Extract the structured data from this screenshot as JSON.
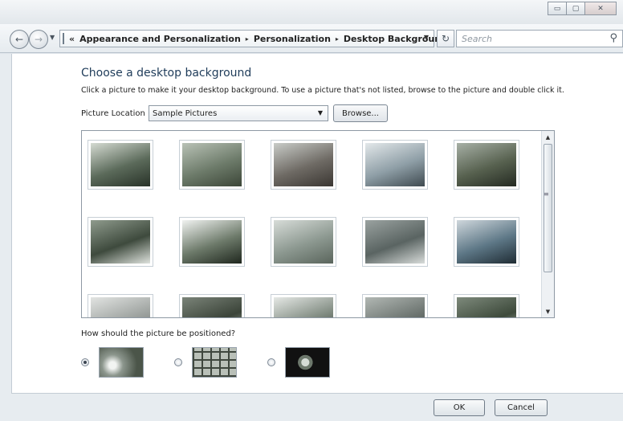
{
  "window": {
    "controls": {
      "minimize": "▭",
      "maximize": "▢",
      "close": "✕"
    }
  },
  "navbar": {
    "back_icon": "back-arrow-icon",
    "forward_icon": "forward-arrow-icon",
    "overflow": "«",
    "breadcrumbs": [
      "Appearance and Personalization",
      "Personalization",
      "Desktop Background"
    ],
    "crumb_separator": "▸",
    "search_placeholder": "Search"
  },
  "content": {
    "heading": "Choose a desktop background",
    "instructions": "Click a picture to make it your desktop background. To use a picture that's not listed, browse to the picture and double click it.",
    "location_label": "Picture Location",
    "location_value": "Sample Pictures",
    "browse_label": "Browse...",
    "thumbnails": [
      {
        "name": "tree-landscape",
        "palette": [
          "#d5dbd2",
          "#5b6a5a",
          "#283228"
        ]
      },
      {
        "name": "stream-field",
        "palette": [
          "#b9c2b6",
          "#6d7b6a",
          "#3c4638"
        ]
      },
      {
        "name": "desert-buttes",
        "palette": [
          "#c9ccc8",
          "#6e6a64",
          "#3a3632"
        ]
      },
      {
        "name": "lake-dock",
        "palette": [
          "#e3e8ea",
          "#8e9ea6",
          "#3f4a50"
        ]
      },
      {
        "name": "forest-path",
        "palette": [
          "#a7b0a6",
          "#57614f",
          "#242a22"
        ]
      },
      {
        "name": "flowers-grass",
        "palette": [
          "#8f9b8d",
          "#3e4a3d",
          "#dfe3de"
        ]
      },
      {
        "name": "white-flowers",
        "palette": [
          "#f1f3f1",
          "#6d7a6a",
          "#1f271e"
        ]
      },
      {
        "name": "daisy-field",
        "palette": [
          "#d7dcd8",
          "#8c9890",
          "#5a655c"
        ]
      },
      {
        "name": "sea-turtle",
        "palette": [
          "#9aa2a0",
          "#5a6462",
          "#d8dcda"
        ]
      },
      {
        "name": "whale-tail",
        "palette": [
          "#cfd7dc",
          "#5d7786",
          "#1f2c34"
        ]
      },
      {
        "name": "sand-dunes",
        "palette": [
          "#e2e4e2",
          "#9da29f",
          "#6a6e6b"
        ]
      },
      {
        "name": "toucan",
        "palette": [
          "#7b8479",
          "#3b4439",
          "#c2c8c0"
        ]
      },
      {
        "name": "bare-tree",
        "palette": [
          "#e6e9e6",
          "#7f8a80",
          "#2f362f"
        ]
      },
      {
        "name": "beach-rocks",
        "palette": [
          "#b2b8b4",
          "#6c7470",
          "#3c423f"
        ]
      },
      {
        "name": "tropical-leaves",
        "palette": [
          "#7e8a7c",
          "#3d4a3b",
          "#cfd6cd"
        ]
      }
    ],
    "position_label": "How should the picture be positioned?",
    "positions": [
      {
        "name": "fill",
        "selected": true
      },
      {
        "name": "tile",
        "selected": false
      },
      {
        "name": "center",
        "selected": false
      }
    ]
  },
  "footer": {
    "ok_label": "OK",
    "cancel_label": "Cancel"
  },
  "colors": {
    "heading": "#1f3c5a",
    "frame": "#dfe5ea",
    "panel": "#ffffff"
  }
}
